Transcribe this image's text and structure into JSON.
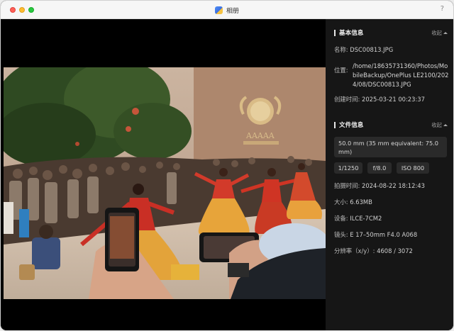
{
  "window": {
    "title": "相册",
    "help_label": "?"
  },
  "basic_info": {
    "heading": "基本信息",
    "collapse_label": "收起",
    "name_key": "名称:",
    "name_value": "DSC00813.JPG",
    "location_key": "位置:",
    "location_value": "/home/18635731360/Photos/MobileBackup/OnePlus LE2100/2024/08/DSC00813.JPG",
    "created_key": "创建时间:",
    "created_value": "2025-03-21 00:23:37"
  },
  "file_info": {
    "heading": "文件信息",
    "collapse_label": "收起",
    "lens_focal": "50.0 mm (35 mm equivalent: 75.0 mm)",
    "shutter": "1/1250",
    "aperture": "f/8.0",
    "iso": "ISO 800",
    "shot_time_key": "拍摄时间:",
    "shot_time_value": "2024-08-22 18:12:43",
    "size_key": "大小:",
    "size_value": "6.63MB",
    "device_key": "设备:",
    "device_value": "ILCE-7CM2",
    "lens_key": "镜头:",
    "lens_value": "E 17–50mm F4.0 A068",
    "resolution_key": "分辨率（x/y）:",
    "resolution_value": "4608 / 3072"
  },
  "photo": {
    "sign_text": "AAAAA",
    "icons": {
      "app": "photos-app-icon",
      "collapse": "caret-up-icon"
    }
  },
  "colors": {
    "panel_bg": "#161616",
    "chip_bg": "#2a2a2a",
    "viewer_bg": "#000000"
  }
}
